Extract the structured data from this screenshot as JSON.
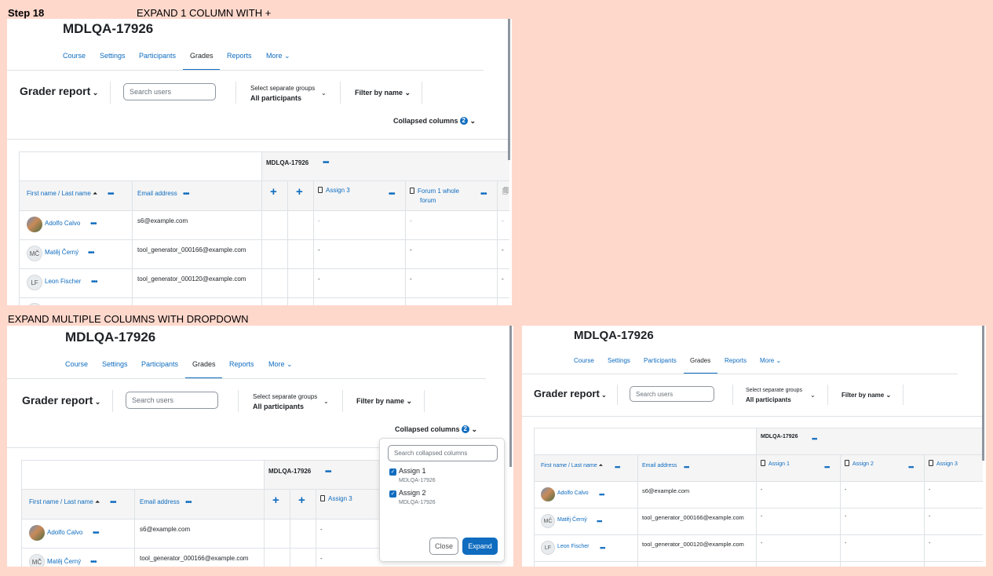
{
  "captions": {
    "step": "Step 18",
    "top": "EXPAND 1 COLUMN WITH +",
    "bottom": "EXPAND MULTIPLE COLUMNS WITH DROPDOWN"
  },
  "course": {
    "title": "MDLQA-17926"
  },
  "nav": {
    "course": "Course",
    "settings": "Settings",
    "participants": "Participants",
    "grades": "Grades",
    "reports": "Reports",
    "more": "More"
  },
  "toolbar": {
    "report_title": "Grader report",
    "search_placeholder": "Search users",
    "groups_label": "Select separate groups",
    "groups_value": "All participants",
    "filter_by_name": "Filter by name",
    "collapsed_columns": "Collapsed columns",
    "collapsed_count": "2"
  },
  "table": {
    "category": "MDLQA-17926",
    "col_name": "First name / Last name",
    "col_email": "Email address",
    "col_assign1": "Assign 1",
    "col_assign2": "Assign 2",
    "col_assign3": "Assign 3",
    "col_forum": "Forum 1 whole forum",
    "col_forum_l1": "Forum 1 whole",
    "col_forum_l2": "forum",
    "empty": "-",
    "rows": [
      {
        "initials": "",
        "name": "Adolfo Calvo",
        "email": "s6@example.com"
      },
      {
        "initials": "MČ",
        "name": "Matěj Černý",
        "email": "tool_generator_000166@example.com"
      },
      {
        "initials": "LF",
        "name": "Leon Fischer",
        "email": "tool_generator_000120@example.com"
      }
    ]
  },
  "dropdown": {
    "search_placeholder": "Search collapsed columns",
    "items": [
      {
        "label": "Assign 1",
        "sub": "MDLQA-17926"
      },
      {
        "label": "Assign 2",
        "sub": "MDLQA-17926"
      }
    ],
    "close": "Close",
    "expand": "Expand"
  },
  "colors": {
    "background": "#ffd8cc",
    "accent": "#0f6cbf"
  }
}
